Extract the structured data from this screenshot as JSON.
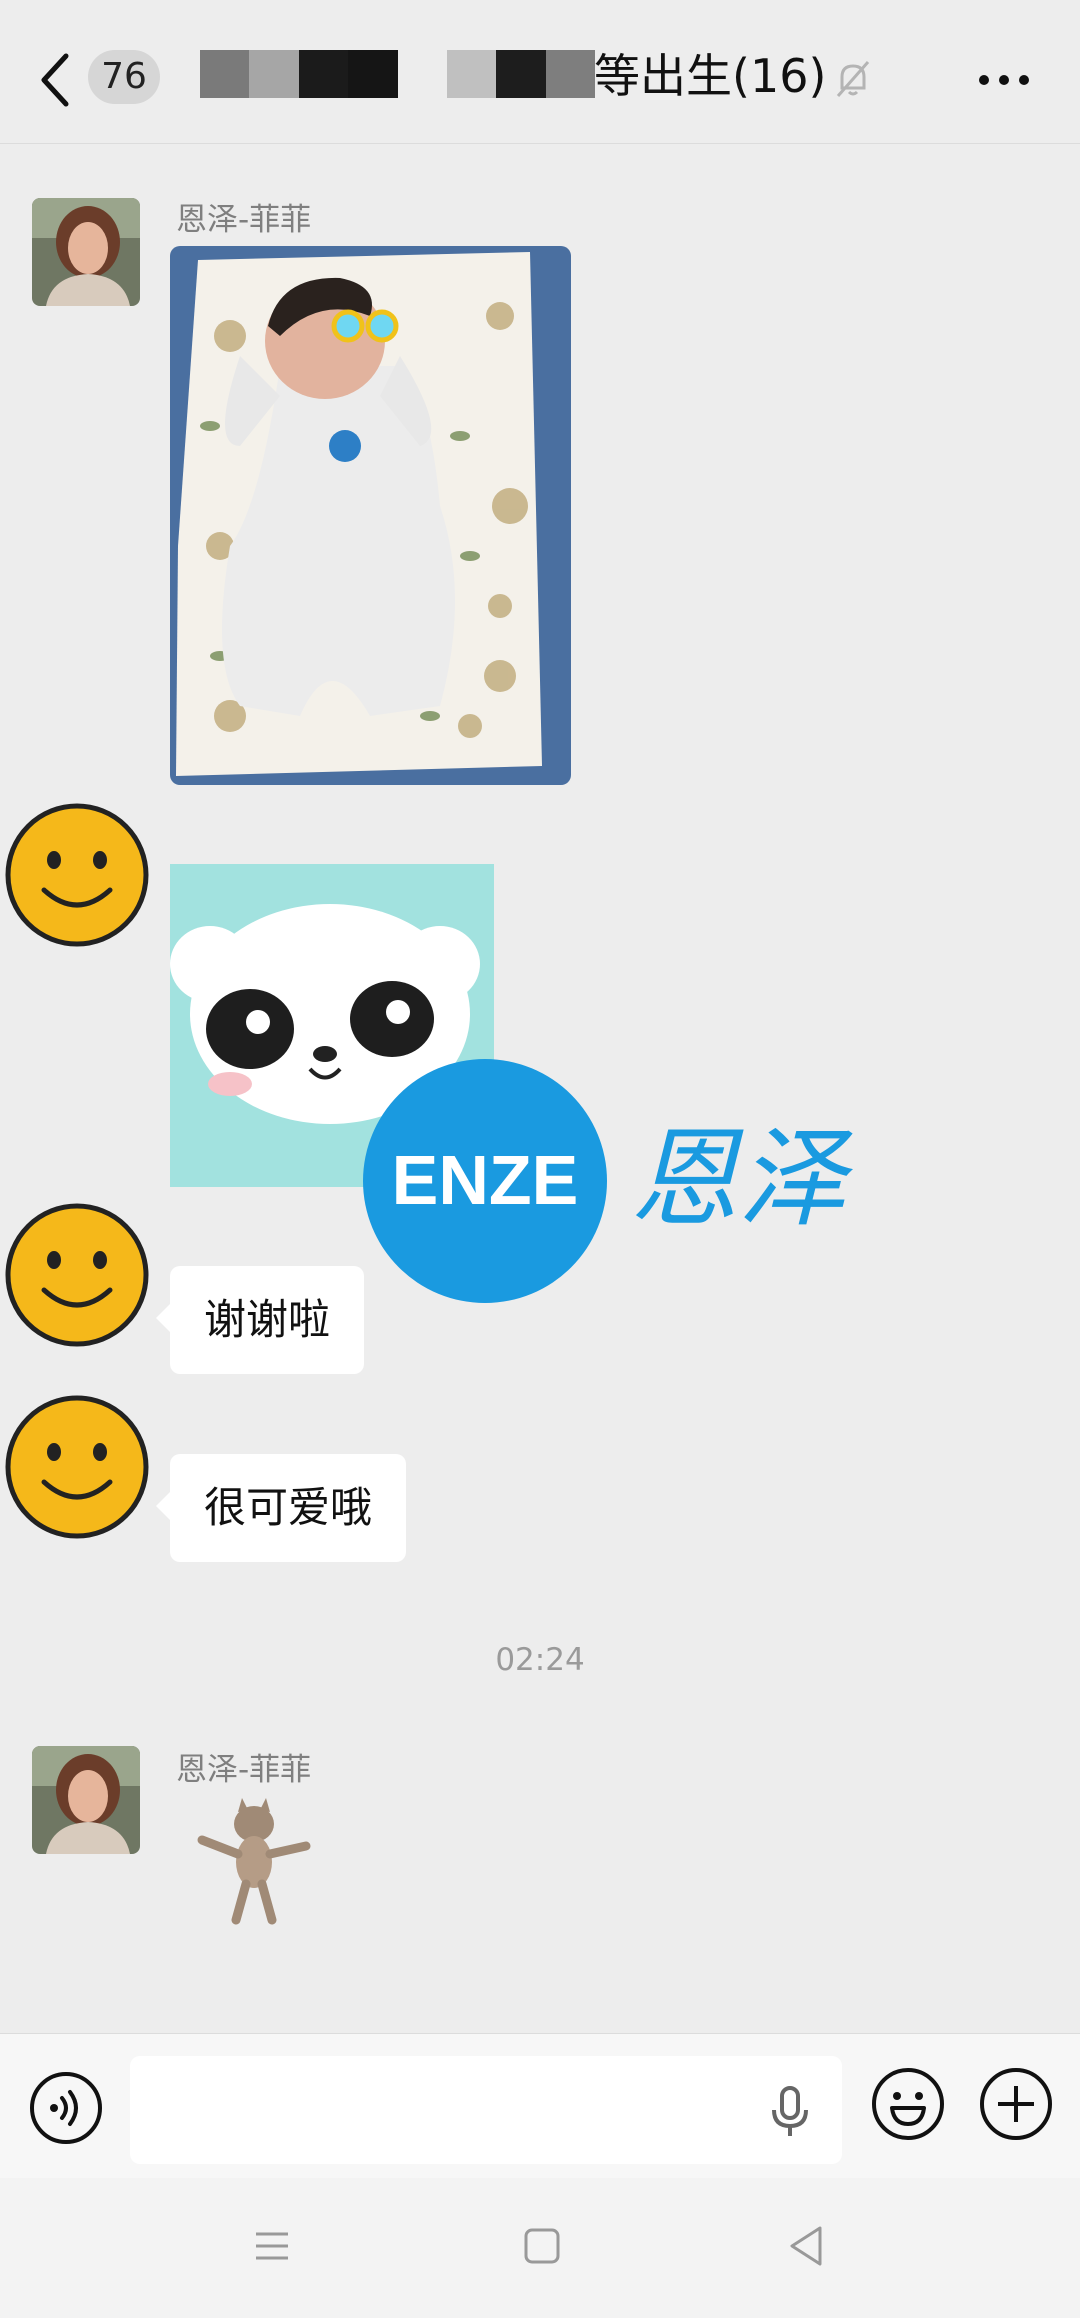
{
  "header": {
    "unread_count": "76",
    "title": "等出生(16)",
    "icons": {
      "back": "chevron-left-icon",
      "mute": "bell-off-icon",
      "more": "more-dots-icon"
    }
  },
  "messages": [
    {
      "type": "image",
      "sender": "恩泽-菲菲",
      "content": "baby-photo"
    },
    {
      "type": "sticker",
      "sender": "",
      "content": "white-dog-sticker"
    },
    {
      "type": "text",
      "sender": "",
      "text": "谢谢啦"
    },
    {
      "type": "text",
      "sender": "",
      "text": "很可爱哦"
    },
    {
      "type": "time",
      "text": "02:24"
    },
    {
      "type": "sticker",
      "sender": "恩泽-菲菲",
      "content": "dancing-cat-sticker"
    }
  ],
  "watermark": {
    "logo_text": "ENZE",
    "chinese": "恩泽"
  },
  "colors": {
    "background": "#ededed",
    "bubble": "#ffffff",
    "watermark_blue": "#1a9ae0",
    "smiley": "#f5b81a"
  }
}
